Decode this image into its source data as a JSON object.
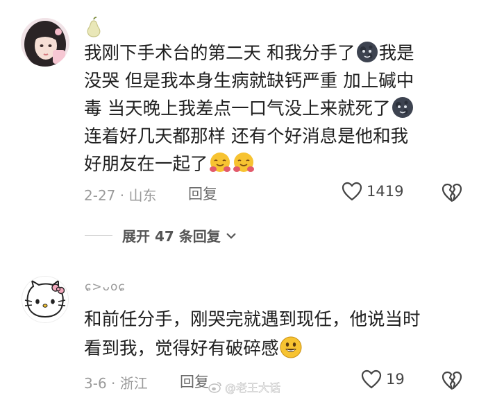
{
  "comments": [
    {
      "lines": [
        {
          "text": "我刚下手术台的第二天 和我分手了",
          "emoji_after": "new-moon-face",
          "tail": "我是"
        },
        {
          "text": "没哭 但是我本身生病就缺钙严重 加上碱中"
        },
        {
          "text": "毒 当天晚上我差点一口气没上来就死了",
          "emoji_after": "new-moon-face"
        },
        {
          "text": "连着好几天都那样  还有个好消息是他和我"
        },
        {
          "text": "好朋友在一起了",
          "emoji_after": "hugging-face-double"
        }
      ],
      "date_location": "2-27 · 山东",
      "reply_label": "回复",
      "like_count": "1419",
      "expand_replies": "展开 47 条回复"
    },
    {
      "username": "ɕ>ᴗoɕ",
      "lines": [
        {
          "text": "和前任分手，刚哭完就遇到现任，他说当时"
        },
        {
          "text": "看到我，觉得好有破碎感",
          "emoji_after": "grinning-face"
        }
      ],
      "date_location": "3-6 · 浙江",
      "reply_label": "回复",
      "like_count": "19"
    }
  ],
  "watermark": "@老王大话",
  "colors": {
    "text": "#202020",
    "meta": "#9a9a9a",
    "accent_moon": "#2f3542",
    "emoji_yellow": "#f7c331"
  }
}
